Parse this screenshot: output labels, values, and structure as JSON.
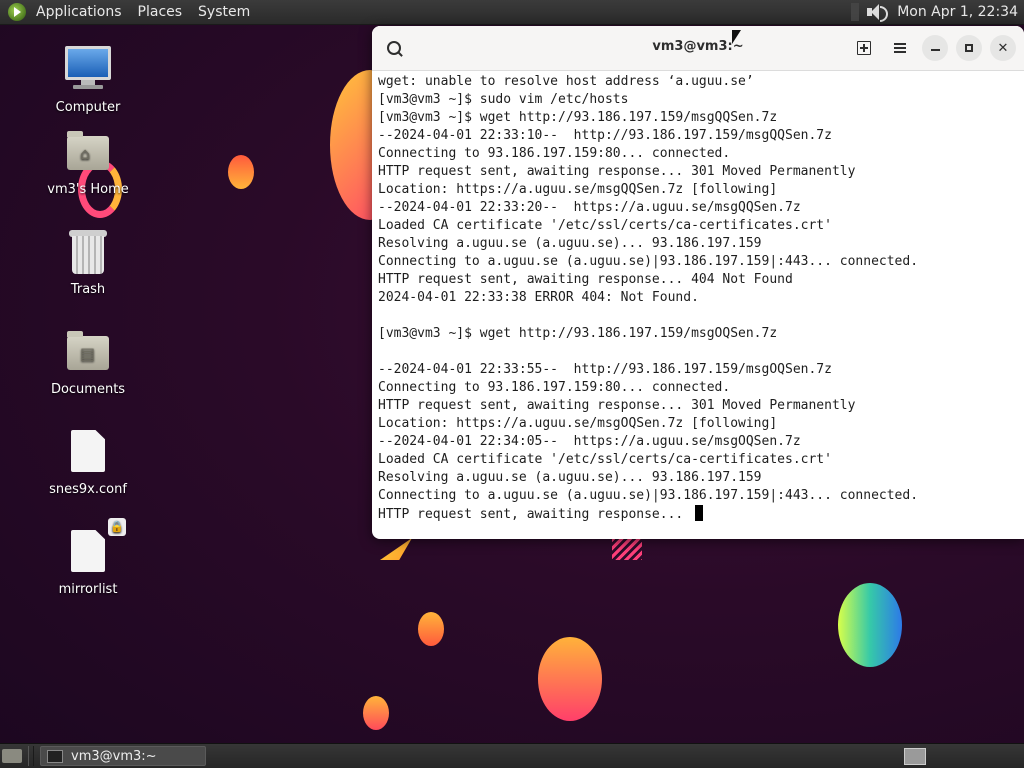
{
  "top_panel": {
    "menu": [
      "Applications",
      "Places",
      "System"
    ],
    "clock": "Mon Apr 1, 22:34"
  },
  "desktop_icons": [
    {
      "label": "Computer",
      "icon": "computer-icon"
    },
    {
      "label": "vm3's Home",
      "icon": "home-folder-icon"
    },
    {
      "label": "Trash",
      "icon": "trash-icon"
    },
    {
      "label": "Documents",
      "icon": "documents-folder-icon"
    },
    {
      "label": "snes9x.conf",
      "icon": "text-file-icon"
    },
    {
      "label": "mirrorlist",
      "icon": "locked-file-icon"
    }
  ],
  "terminal": {
    "title": "vm3@vm3:~",
    "lines": [
      "wget: unable to resolve host address ‘a.uguu.se’",
      "[vm3@vm3 ~]$ sudo vim /etc/hosts",
      "[vm3@vm3 ~]$ wget http://93.186.197.159/msgQQSen.7z",
      "--2024-04-01 22:33:10--  http://93.186.197.159/msgQQSen.7z",
      "Connecting to 93.186.197.159:80... connected.",
      "HTTP request sent, awaiting response... 301 Moved Permanently",
      "Location: https://a.uguu.se/msgQQSen.7z [following]",
      "--2024-04-01 22:33:20--  https://a.uguu.se/msgQQSen.7z",
      "Loaded CA certificate '/etc/ssl/certs/ca-certificates.crt'",
      "Resolving a.uguu.se (a.uguu.se)... 93.186.197.159",
      "Connecting to a.uguu.se (a.uguu.se)|93.186.197.159|:443... connected.",
      "HTTP request sent, awaiting response... 404 Not Found",
      "2024-04-01 22:33:38 ERROR 404: Not Found.",
      "",
      "[vm3@vm3 ~]$ wget http://93.186.197.159/msgOQSen.7z",
      "",
      "--2024-04-01 22:33:55--  http://93.186.197.159/msgOQSen.7z",
      "Connecting to 93.186.197.159:80... connected.",
      "HTTP request sent, awaiting response... 301 Moved Permanently",
      "Location: https://a.uguu.se/msgOQSen.7z [following]",
      "--2024-04-01 22:34:05--  https://a.uguu.se/msgOQSen.7z",
      "Loaded CA certificate '/etc/ssl/certs/ca-certificates.crt'",
      "Resolving a.uguu.se (a.uguu.se)... 93.186.197.159",
      "Connecting to a.uguu.se (a.uguu.se)|93.186.197.159|:443... connected.",
      "HTTP request sent, awaiting response... "
    ]
  },
  "taskbar": {
    "tasks": [
      "vm3@vm3:~"
    ]
  },
  "colors": {
    "desktop_bg": "#2a0a28",
    "panel_bg": "#2a2a2a",
    "terminal_bg": "#ffffff",
    "terminal_text": "#1e1e1e"
  }
}
